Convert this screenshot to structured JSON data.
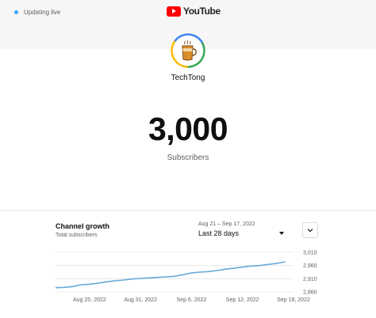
{
  "header": {
    "live_label": "Updating live",
    "brand_text": "YouTube",
    "brand_color": "#ff0000"
  },
  "channel": {
    "name": "TechTong",
    "subscriber_count": "3,000",
    "subscriber_label": "Subscribers",
    "avatar_icon": "tea-mug-icon",
    "avatar_ring_colors": [
      "#4285f4",
      "#34a853",
      "#fbbc05"
    ]
  },
  "growth_card": {
    "title": "Channel growth",
    "subtitle": "Total subscribers",
    "date_range": "Aug 21 – Sep 17, 2022",
    "period_label": "Last 28 days",
    "expand_icon": "chevron-down-icon"
  },
  "chart_data": {
    "type": "line",
    "title": "Channel growth",
    "ylabel": "Total subscribers",
    "x": [
      "2022-08-21",
      "2022-08-22",
      "2022-08-23",
      "2022-08-24",
      "2022-08-25",
      "2022-08-26",
      "2022-08-27",
      "2022-08-28",
      "2022-08-29",
      "2022-08-30",
      "2022-08-31",
      "2022-09-01",
      "2022-09-02",
      "2022-09-03",
      "2022-09-04",
      "2022-09-05",
      "2022-09-06",
      "2022-09-07",
      "2022-09-08",
      "2022-09-09",
      "2022-09-10",
      "2022-09-11",
      "2022-09-12",
      "2022-09-13",
      "2022-09-14",
      "2022-09-15",
      "2022-09-16",
      "2022-09-17"
    ],
    "series": [
      {
        "values": [
          2876,
          2877,
          2880,
          2887,
          2889,
          2893,
          2898,
          2902,
          2905,
          2909,
          2911,
          2913,
          2915,
          2917,
          2919,
          2925,
          2932,
          2935,
          2937,
          2941,
          2946,
          2950,
          2954,
          2958,
          2960,
          2964,
          2968,
          2974
        ],
        "color": "#65a9d6"
      }
    ],
    "ylim": [
      2860,
      3010
    ],
    "y_ticks": [
      "2,860",
      "2,910",
      "2,960",
      "3,010"
    ],
    "x_ticks": [
      "Aug 25, 2022",
      "Aug 31, 2022",
      "Sep 6, 2022",
      "Sep 12, 2022",
      "Sep 18, 2022"
    ],
    "grid": true
  }
}
